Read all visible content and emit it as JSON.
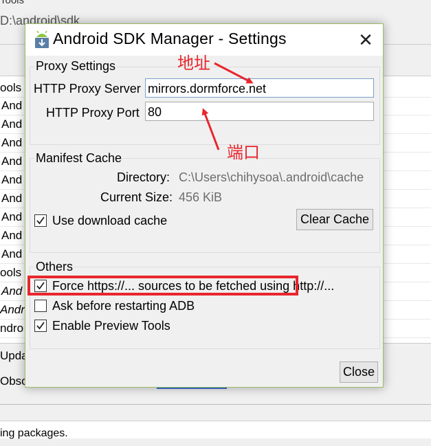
{
  "background": {
    "menu_fragment": "Tools",
    "path_fragment": "D:\\android\\sdk",
    "rows": [
      "ools",
      "And",
      "And",
      "And",
      "And",
      "And",
      "And",
      "And",
      "And",
      "And",
      "ools (",
      "And",
      "Andr",
      "ndro"
    ],
    "updates_fragment": "Upda",
    "obsolete_fragment": "Obso",
    "status_fragment": "ing packages."
  },
  "dialog": {
    "title": "Android SDK Manager - Settings",
    "close_glyph": "✕",
    "proxy": {
      "group_label": "Proxy Settings",
      "server_label": "HTTP Proxy Server",
      "server_value": "mirrors.dormforce.net",
      "port_label": "HTTP Proxy Port",
      "port_value": "80"
    },
    "manifest": {
      "group_label": "Manifest Cache",
      "directory_label": "Directory:",
      "directory_value": "C:\\Users\\chihysoa\\.android\\cache",
      "size_label": "Current Size:",
      "size_value": "456 KiB",
      "use_cache_label": "Use download cache",
      "use_cache_checked": true,
      "clear_button": "Clear Cache"
    },
    "others": {
      "group_label": "Others",
      "force_http_label": "Force https://... sources to be fetched using http://...",
      "force_http_checked": true,
      "ask_restart_label": "Ask before restarting ADB",
      "ask_restart_checked": false,
      "preview_tools_label": "Enable Preview Tools",
      "preview_tools_checked": true
    },
    "close_button": "Close"
  },
  "annotations": {
    "address_label": "地址",
    "port_label": "端口",
    "color": "#e8262d"
  }
}
